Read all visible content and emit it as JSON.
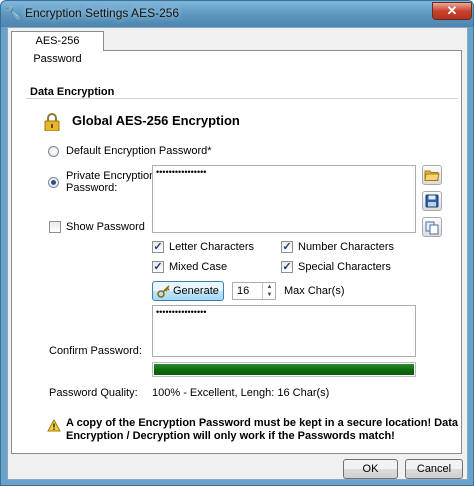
{
  "window": {
    "title": "Encryption Settings AES-256",
    "close_label": "✕"
  },
  "tab": {
    "label": "AES-256 Password"
  },
  "group": {
    "title": "Data Encryption"
  },
  "heading": "Global AES-256 Encryption",
  "radio_default": {
    "label": "Default Encryption Password*",
    "selected": false
  },
  "radio_private": {
    "label_line1": "Private Encryption",
    "label_line2": "Password:",
    "selected": true
  },
  "password_field": {
    "value": "••••••••••••••••"
  },
  "show_password": {
    "label": "Show Password",
    "checked": false
  },
  "options": {
    "letter": {
      "label": "Letter Characters",
      "checked": true
    },
    "number": {
      "label": "Number Characters",
      "checked": true
    },
    "mixed": {
      "label": "Mixed Case",
      "checked": true
    },
    "special": {
      "label": "Special Characters",
      "checked": true
    }
  },
  "generate": {
    "label": "Generate",
    "length_value": "16",
    "max_label": "Max Char(s)"
  },
  "confirm": {
    "label": "Confirm Password:",
    "value": "••••••••••••••••"
  },
  "quality": {
    "label": "Password Quality:",
    "text": "100% - Excellent, Lengh: 16 Char(s)",
    "fraction": 1.0,
    "color": "#0d6b0d"
  },
  "warning": {
    "line1": "A copy of the Encryption Password must be kept in a secure location! Data",
    "line2": "Encryption / Decryption will only work if the Passwords match!"
  },
  "buttons": {
    "ok": "OK",
    "cancel": "Cancel"
  }
}
